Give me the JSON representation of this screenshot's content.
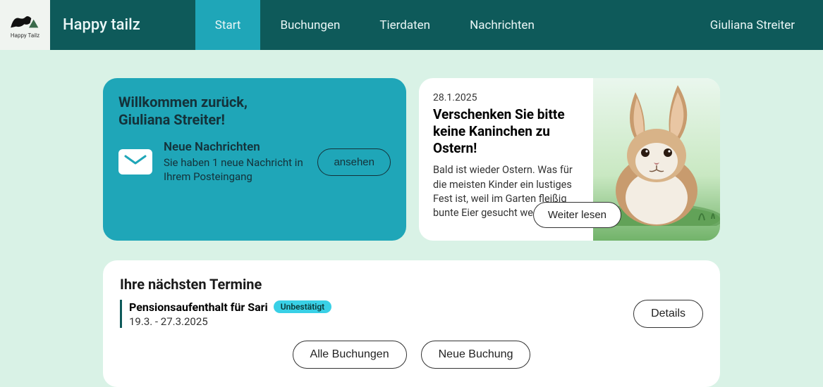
{
  "brand": "Happy tailz",
  "logo_caption": "Happy Tailz",
  "nav": {
    "start": "Start",
    "buchungen": "Buchungen",
    "tierdaten": "Tierdaten",
    "nachrichten": "Nachrichten",
    "user": "Giuliana Streiter"
  },
  "welcome": {
    "line1": "Willkommen zurück,",
    "line2": "Giuliana Streiter!",
    "messages_heading": "Neue Nachrichten",
    "messages_body": "Sie haben 1 neue Nachricht in Ihrem Posteingang",
    "view_button": "ansehen"
  },
  "news": {
    "date": "28.1.2025",
    "title": "Verschenken Sie bitte keine Kaninchen zu Ostern!",
    "body": "Bald ist wieder Ostern. Was für die meisten Kinder ein lustiges Fest ist, weil im Garten fleißig bunte Eier gesucht werden, ist für …",
    "read_more": "Weiter lesen"
  },
  "appointments": {
    "heading": "Ihre nächsten Termine",
    "item": {
      "title": "Pensionsaufenthalt für Sari",
      "status": "Unbestätigt",
      "dates": "19.3. - 27.3.2025"
    },
    "details_button": "Details",
    "all_button": "Alle Buchungen",
    "new_button": "Neue Buchung"
  }
}
